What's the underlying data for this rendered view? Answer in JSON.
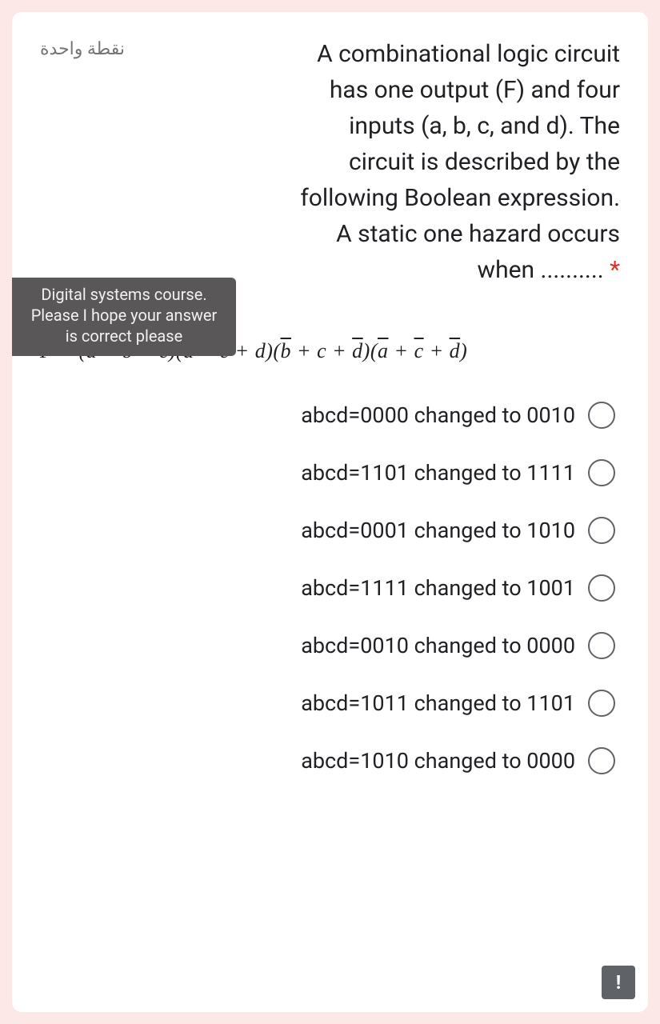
{
  "question": {
    "points_label": "نقطة واحدة",
    "text_line1": "A combinational logic circuit",
    "text_line2": "has one output (F) and four",
    "text_line3": "inputs (a, b, c, and d). The",
    "text_line4": "circuit is described by the",
    "text_line5": "following Boolean expression.",
    "text_line6": "A static one hazard occurs",
    "text_line7_prefix": "when",
    "required_mark": "*",
    "dots": " .......... "
  },
  "tooltip": {
    "line1": "Digital systems course.",
    "line2": "Please I hope your answer",
    "line3": "is correct please"
  },
  "formula": {
    "F": "F",
    "eq": " = ",
    "t1a": "(a + b + ",
    "t1b": "c",
    "t1c": ")",
    "t2": "(a + c + d)",
    "t3a": "(",
    "t3b": "b",
    "t3c": " + c + ",
    "t3d": "d",
    "t3e": ")",
    "t4a": "(",
    "t4b": "a",
    "t4c": " + ",
    "t4d": "c",
    "t4e": " + ",
    "t4f": "d",
    "t4g": ")"
  },
  "options": [
    {
      "label": "abcd=0000 changed to 0010"
    },
    {
      "label": "abcd=1101 changed to 1111"
    },
    {
      "label": "abcd=0001 changed to 1010"
    },
    {
      "label": "abcd=1111 changed to 1001"
    },
    {
      "label": "abcd=0010 changed to 0000"
    },
    {
      "label": "abcd=1011 changed to 1101"
    },
    {
      "label": "abcd=1010 changed to 0000"
    }
  ],
  "alert_icon": "!"
}
